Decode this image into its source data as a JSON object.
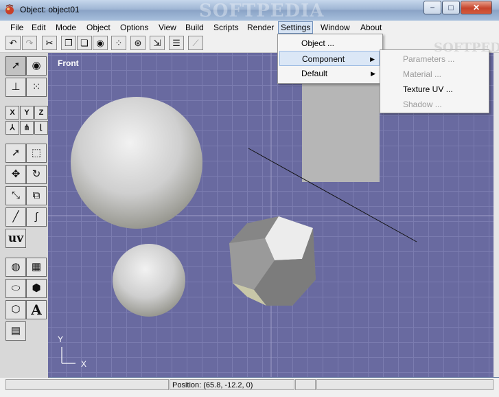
{
  "window": {
    "title": "Object: object01",
    "watermark": "SOFTPEDIA"
  },
  "titlebar": {
    "minimize": "−",
    "maximize": "□",
    "close": "✕"
  },
  "menubar": [
    "File",
    "Edit",
    "Mode",
    "Object",
    "Options",
    "View",
    "Build",
    "Scripts",
    "Render",
    "Settings",
    "Window",
    "About"
  ],
  "settings_menu": {
    "items": [
      {
        "label": "Object ...",
        "submenu": false
      },
      {
        "label": "Component",
        "submenu": true
      },
      {
        "label": "Default",
        "submenu": true
      }
    ]
  },
  "component_menu": {
    "items": [
      {
        "label": "Parameters ...",
        "enabled": false
      },
      {
        "label": "Material ...",
        "enabled": false
      },
      {
        "label": "Texture UV ...",
        "enabled": true
      },
      {
        "label": "Shadow ...",
        "enabled": false
      }
    ]
  },
  "viewport": {
    "label": "Front",
    "axis_y": "Y",
    "axis_x": "X"
  },
  "palette": {
    "xyz": [
      "X",
      "Y",
      "Z"
    ],
    "uv_label": "uv",
    "text_label": "A"
  },
  "statusbar": {
    "position": "Position: (65.8, -12.2, 0)"
  },
  "menu_watermark": "SOFTPEDIA"
}
